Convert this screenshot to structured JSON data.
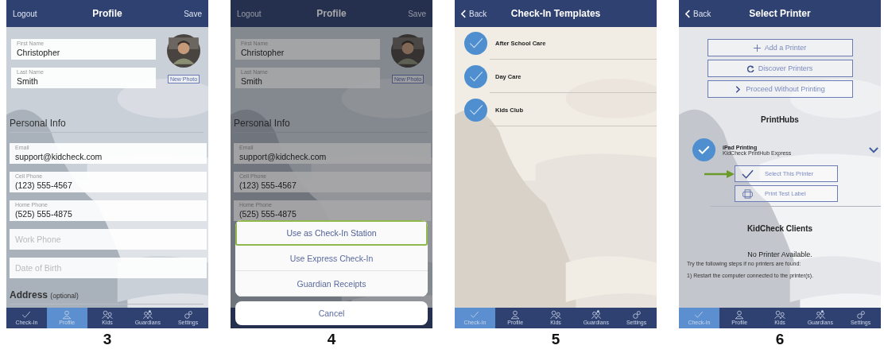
{
  "screens": [
    {
      "kind": "profile",
      "number": "3",
      "nav": {
        "left": "Logout",
        "title": "Profile",
        "right": "Save"
      },
      "name_fields": [
        {
          "label": "First Name",
          "value": "Christopher"
        },
        {
          "label": "Last Name",
          "value": "Smith"
        }
      ],
      "photo_button": "New Photo",
      "section": "Personal Info",
      "fields": [
        {
          "label": "Email",
          "value": "support@kidcheck.com"
        },
        {
          "label": "Cell Phone",
          "value": "(123) 555-4567"
        },
        {
          "label": "Home Phone",
          "value": "(525) 555-4875"
        },
        {
          "placeholder": "Work Phone"
        },
        {
          "placeholder": "Date of Birth"
        }
      ],
      "address": {
        "title": "Address",
        "note": "(optional)"
      },
      "tabs": [
        {
          "kind": "checkin",
          "label": "Check-In",
          "selected": false
        },
        {
          "kind": "profile",
          "label": "Profile",
          "selected": true
        },
        {
          "kind": "kids",
          "label": "Kids",
          "selected": false
        },
        {
          "kind": "guardians",
          "label": "Guardians",
          "selected": false
        },
        {
          "kind": "settings",
          "label": "Settings",
          "selected": false
        }
      ]
    },
    {
      "kind": "profile",
      "number": "4",
      "nav": {
        "left": "Logout",
        "title": "Profile",
        "right": "Save"
      },
      "name_fields": [
        {
          "label": "First Name",
          "value": "Christopher"
        },
        {
          "label": "Last Name",
          "value": "Smith"
        }
      ],
      "photo_button": "New Photo",
      "section": "Personal Info",
      "fields": [
        {
          "label": "Email",
          "value": "support@kidcheck.com"
        },
        {
          "label": "Cell Phone",
          "value": "(123) 555-4567"
        },
        {
          "label": "Home Phone",
          "value": "(525) 555-4875"
        }
      ],
      "sheet": {
        "actions": [
          {
            "label": "Use as Check-In Station",
            "selected": true
          },
          {
            "label": "Use Express Check-In",
            "selected": false
          },
          {
            "label": "Guardian Receipts",
            "selected": false
          }
        ],
        "cancel": "Cancel"
      }
    },
    {
      "kind": "templates",
      "number": "5",
      "nav": {
        "back": "Back",
        "title": "Check-In Templates"
      },
      "templates": [
        {
          "name": "After School Care",
          "checked": true
        },
        {
          "name": "Day Care",
          "checked": true
        },
        {
          "name": "Kids Club",
          "checked": true
        }
      ],
      "tabs": [
        {
          "kind": "checkin",
          "label": "Check-In",
          "selected": true
        },
        {
          "kind": "profile",
          "label": "Profile",
          "selected": false
        },
        {
          "kind": "kids",
          "label": "Kids",
          "selected": false
        },
        {
          "kind": "guardians",
          "label": "Guardians",
          "selected": false
        },
        {
          "kind": "settings",
          "label": "Settings",
          "selected": false
        }
      ]
    },
    {
      "kind": "printer",
      "number": "6",
      "nav": {
        "back": "Back",
        "title": "Select Printer"
      },
      "actions": [
        {
          "kind": "add",
          "label": "Add a Printer"
        },
        {
          "kind": "discover",
          "label": "Discover Printers"
        },
        {
          "kind": "proceed",
          "label": "Proceed Without Printing"
        }
      ],
      "printhubs": {
        "title": "PrintHubs",
        "printer": {
          "name": "iPad Printing",
          "model": "KidCheck PrintHub Express",
          "checked": true
        },
        "buttons": [
          {
            "kind": "select",
            "label": "Select This Printer"
          },
          {
            "kind": "test",
            "label": "Print Test Label"
          }
        ]
      },
      "clients": {
        "title": "KidCheck Clients",
        "status": "No Printer Available.",
        "hint": "Try the following steps if no printers are found:",
        "steps": [
          "1) Restart the computer connected to the printer(s)."
        ]
      },
      "tabs": [
        {
          "kind": "checkin",
          "label": "Check-In",
          "selected": true
        },
        {
          "kind": "profile",
          "label": "Profile",
          "selected": false
        },
        {
          "kind": "kids",
          "label": "Kids",
          "selected": false
        },
        {
          "kind": "guardians",
          "label": "Guardians",
          "selected": false
        },
        {
          "kind": "settings",
          "label": "Settings",
          "selected": false
        }
      ]
    }
  ]
}
